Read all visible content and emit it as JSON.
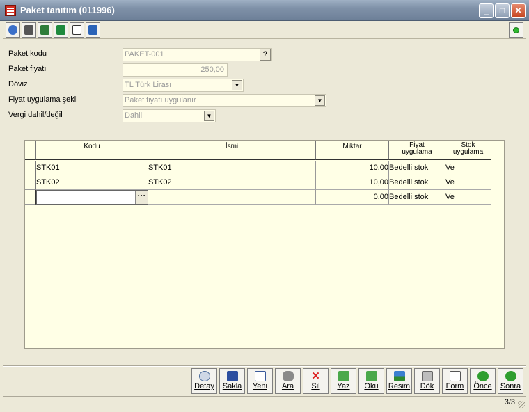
{
  "window": {
    "title": "Paket tanıtım (011996)",
    "min": "_",
    "max": "□",
    "close": "✕"
  },
  "toolbar": {
    "icons": [
      "help-icon",
      "calculator-icon",
      "report-icon",
      "excel-icon",
      "home-icon",
      "print-preview-icon"
    ],
    "status_color": "#2fb82f"
  },
  "form": {
    "paket_kodu": {
      "label": "Paket kodu",
      "value": "PAKET-001",
      "lookup": "?"
    },
    "paket_fiyati": {
      "label": "Paket fiyatı",
      "value": "250,00"
    },
    "doviz": {
      "label": "Döviz",
      "value": "TL  Türk Lirası"
    },
    "fiyat_uygulama": {
      "label": "Fiyat uygulama şekli",
      "value": "Paket fiyatı uygulanır"
    },
    "vergi": {
      "label": "Vergi dahil/değil",
      "value": "Dahil"
    }
  },
  "grid": {
    "headers": {
      "kodu": "Kodu",
      "ismi": "İsmi",
      "miktar": "Miktar",
      "fiyat_line1": "Fiyat",
      "fiyat_line2": "uygulama",
      "stok_line1": "Stok",
      "stok_line2": "uygulama"
    },
    "rows": [
      {
        "kodu": "STK01",
        "ismi": "STK01",
        "miktar": "10,00",
        "fiyat": "Bedelli stok",
        "stok": "Ve"
      },
      {
        "kodu": "STK02",
        "ismi": "STK02",
        "miktar": "10,00",
        "fiyat": "Bedelli stok",
        "stok": "Ve"
      },
      {
        "kodu": "",
        "ismi": "",
        "miktar": "0,00",
        "fiyat": "Bedelli stok",
        "stok": "Ve"
      }
    ],
    "ellipsis": "···"
  },
  "actions": {
    "detay": "Detay",
    "sakla": "Sakla",
    "yeni": "Yeni",
    "ara": "Ara",
    "sil": "Sil",
    "yaz": "Yaz",
    "oku": "Oku",
    "resim": "Resim",
    "dok": "Dök",
    "form": "Form",
    "once": "Önce",
    "sonra": "Sonra"
  },
  "status": {
    "page": "3/3"
  }
}
